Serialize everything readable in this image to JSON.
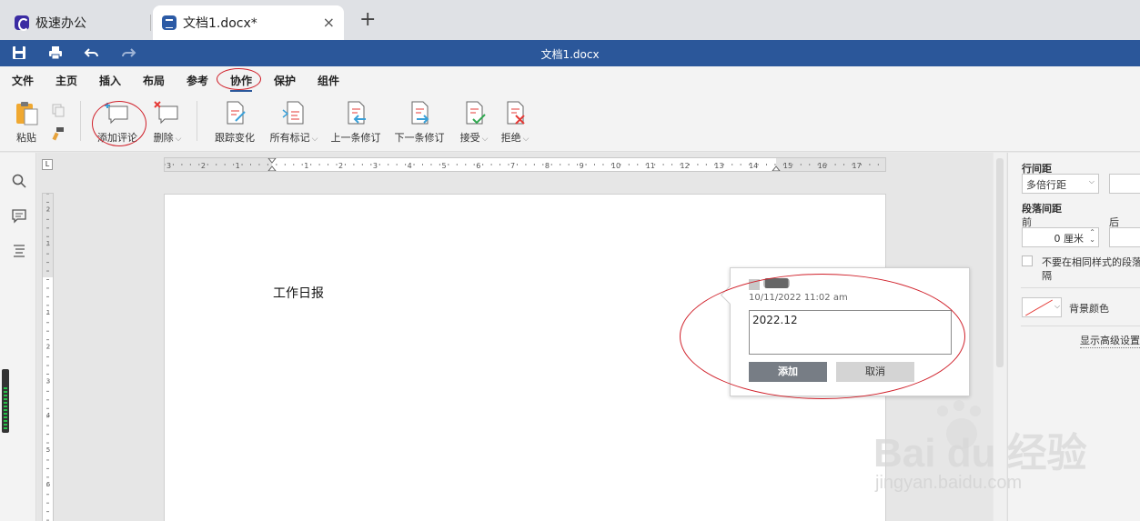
{
  "tabs": [
    {
      "label": "极速办公",
      "icon": "app-logo-icon",
      "active": false
    },
    {
      "label": "文档1.docx*",
      "icon": "document-icon",
      "active": true
    }
  ],
  "new_tab_label": "+",
  "close_tab_label": "×",
  "title_bar": {
    "doc_title": "文档1.docx",
    "quick_actions": [
      "save-icon",
      "print-icon",
      "undo-icon",
      "redo-icon"
    ]
  },
  "menu": {
    "items": [
      "文件",
      "主页",
      "插入",
      "布局",
      "参考",
      "协作",
      "保护",
      "组件"
    ],
    "active": "协作"
  },
  "toolbar": {
    "paste": "粘贴",
    "add_comment": "添加评论",
    "delete": "删除",
    "track_changes": "跟踪变化",
    "all_markup": "所有标记",
    "prev_change": "上一条修订",
    "next_change": "下一条修订",
    "accept": "接受",
    "reject": "拒绝"
  },
  "document": {
    "body_text": "工作日报"
  },
  "comment": {
    "author": "███",
    "timestamp": "10/11/2022 11:02 am",
    "input_value": "2022.12",
    "add_button": "添加",
    "cancel_button": "取消"
  },
  "right_panel": {
    "line_spacing_label": "行间距",
    "line_spacing_value": "多倍行距",
    "paragraph_spacing_label": "段落间距",
    "before_label": "前",
    "after_label": "后",
    "before_value": "0 厘米",
    "no_space_same_style": "不要在相同样式的段落",
    "no_space_same_style_cont": "隔",
    "background_color_label": "背景颜色",
    "advanced_settings": "显示高级设置"
  },
  "ruler": {
    "corner_label": "L",
    "h_ticks": [
      "3",
      "2",
      "1",
      "1",
      "2",
      "3",
      "4",
      "5",
      "6",
      "7",
      "8",
      "9",
      "10",
      "11",
      "12",
      "13",
      "14",
      "15",
      "16",
      "17"
    ],
    "v_ticks": [
      "2",
      "1",
      "1",
      "2",
      "3",
      "4",
      "5",
      "6"
    ]
  },
  "watermark": {
    "main": "Bai du 经验",
    "sub": "jingyan.baidu.com"
  },
  "colors": {
    "title_bar": "#2b579a",
    "annotation": "#d0202a",
    "add_button": "#777d85"
  }
}
